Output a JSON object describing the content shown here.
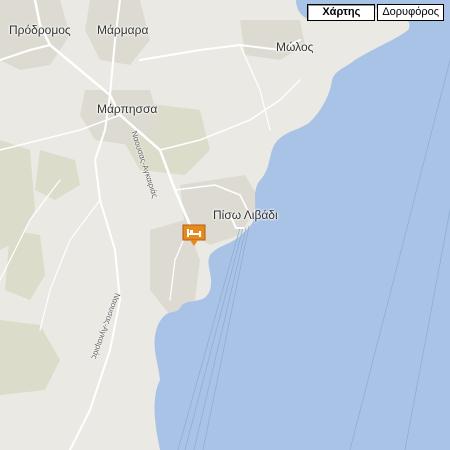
{
  "map_type_control": {
    "options": [
      {
        "label": "Χάρτης",
        "selected": true
      },
      {
        "label": "Δορυφόρος",
        "selected": false
      }
    ]
  },
  "places": {
    "prodromos": "Πρόδρομος",
    "marmara": "Μάρμαρα",
    "molos": "Μώλος",
    "marpissa": "Μάρπησσα",
    "piso_livadi": "Πίσω Λιβάδι"
  },
  "roads": {
    "road_1": "Ναουσας-Αγκαιριάς",
    "road_2": "Ναουσας-Αγκαιριάς"
  },
  "marker": {
    "icon": "hotel-icon",
    "color": "#e8891e"
  },
  "colors": {
    "sea": "#a9c3e6",
    "land": "#ebe9e4",
    "urban": "#dedcd2",
    "vegetation": "#d9d9c5"
  }
}
